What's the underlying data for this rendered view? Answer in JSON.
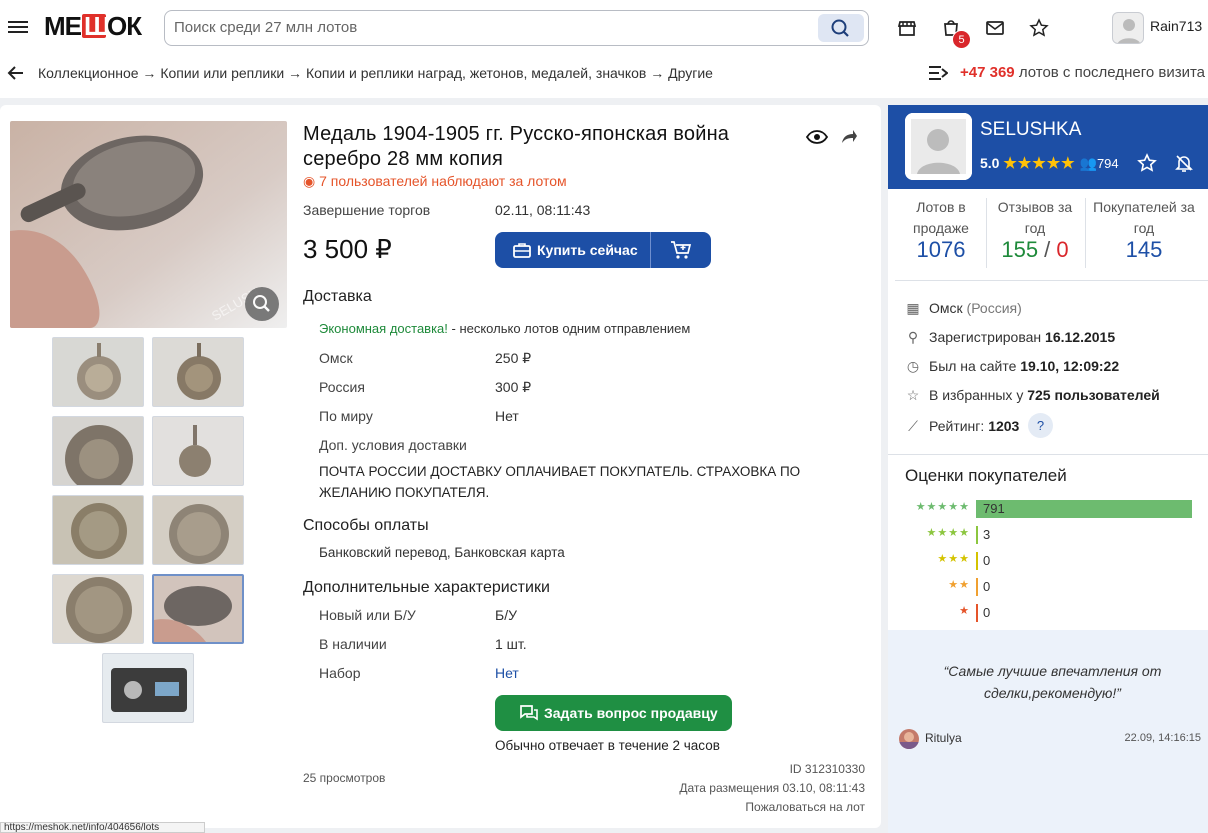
{
  "header": {
    "logo": "МЕШОК",
    "search_placeholder": "Поиск среди 27 млн лотов",
    "cart_badge": "5",
    "username": "Rain713"
  },
  "breadcrumbs": "Коллекционное → Копии или реплики → Копии и реплики наград, жетонов, медалей, значков → Другие",
  "new_lots": {
    "count": "+47 369",
    "text": "лотов с последнего визита"
  },
  "lot": {
    "title": "Медаль 1904-1905 гг. Русско-японская война серебро 28 мм копия",
    "watchers": "7 пользователей наблюдают за лотом",
    "end_label": "Завершение торгов",
    "end_value": "02.11, 08:11:43",
    "price": "3 500 ₽",
    "buy_label": "Купить сейчас",
    "delivery_heading": "Доставка",
    "econ_link": "Экономная доставка!",
    "econ_text": " - несколько лотов одним отправлением",
    "delivery_rows": [
      {
        "label": "Омск",
        "value": "250 ₽"
      },
      {
        "label": "Россия",
        "value": "300 ₽"
      },
      {
        "label": "По миру",
        "value": "Нет"
      }
    ],
    "extra_label": "Доп. условия доставки",
    "extra_text": "ПОЧТА РОССИИ ДОСТАВКУ ОПЛАЧИВАЕТ ПОКУПАТЕЛЬ. СТРАХОВКА ПО ЖЕЛАНИЮ ПОКУПАТЕЛЯ.",
    "payment_heading": "Способы оплаты",
    "payment_text": "Банковский перевод, Банковская карта",
    "chars_heading": "Дополнительные характеристики",
    "chars": [
      {
        "label": "Новый или Б/У",
        "value": "Б/У"
      },
      {
        "label": "В наличии",
        "value": "1 шт."
      },
      {
        "label": "Набор",
        "value": "Нет"
      }
    ],
    "ask_label": "Задать вопрос продавцу",
    "reply_note": "Обычно отвечает в течение 2 часов",
    "views": "25 просмотров",
    "lot_id": "ID 312310330",
    "placed": "Дата размещения 03.10, 08:11:43",
    "complain": "Пожаловаться на лот"
  },
  "seller": {
    "name": "SELUSHKA",
    "rating": "5.0",
    "stars": "★★★★★",
    "followers": "794",
    "stats": [
      {
        "label": "Лотов в продаже",
        "value": "1076"
      },
      {
        "label": "Отзывов за год",
        "pos": "155",
        "slash": " / ",
        "neg": "0"
      },
      {
        "label": "Покупателей за год",
        "value": "145"
      }
    ],
    "city": "Омск",
    "country": "(Россия)",
    "registered_label": "Зарегистрирован",
    "registered_value": "16.12.2015",
    "seen_label": "Был на сайте",
    "seen_value": "19.10, 12:09:22",
    "fav_label": "В избранных у",
    "fav_value": "725 пользователей",
    "rating_label": "Рейтинг:",
    "rating_value": "1203",
    "help": "?"
  },
  "reviews": {
    "heading": "Оценки покупателей",
    "rows": [
      {
        "stars": "★★★★★",
        "count": "791",
        "fraction": 1.0,
        "color": "#6dbb6f"
      },
      {
        "stars": "★★★★",
        "count": "3",
        "fraction": 0.0,
        "color": "#8cc63f"
      },
      {
        "stars": "★★★",
        "count": "0",
        "fraction": 0.0,
        "color": "#d4c300"
      },
      {
        "stars": "★★",
        "count": "0",
        "fraction": 0.0,
        "color": "#f0a030"
      },
      {
        "stars": "★",
        "count": "0",
        "fraction": 0.0,
        "color": "#e5542a"
      }
    ],
    "quote": "“Самые лучшие впечатления от сделки,рекомендую!”",
    "author": "Ritulya",
    "date": "22.09, 14:16:15"
  },
  "statusbar": "https://meshok.net/info/404656/lots"
}
